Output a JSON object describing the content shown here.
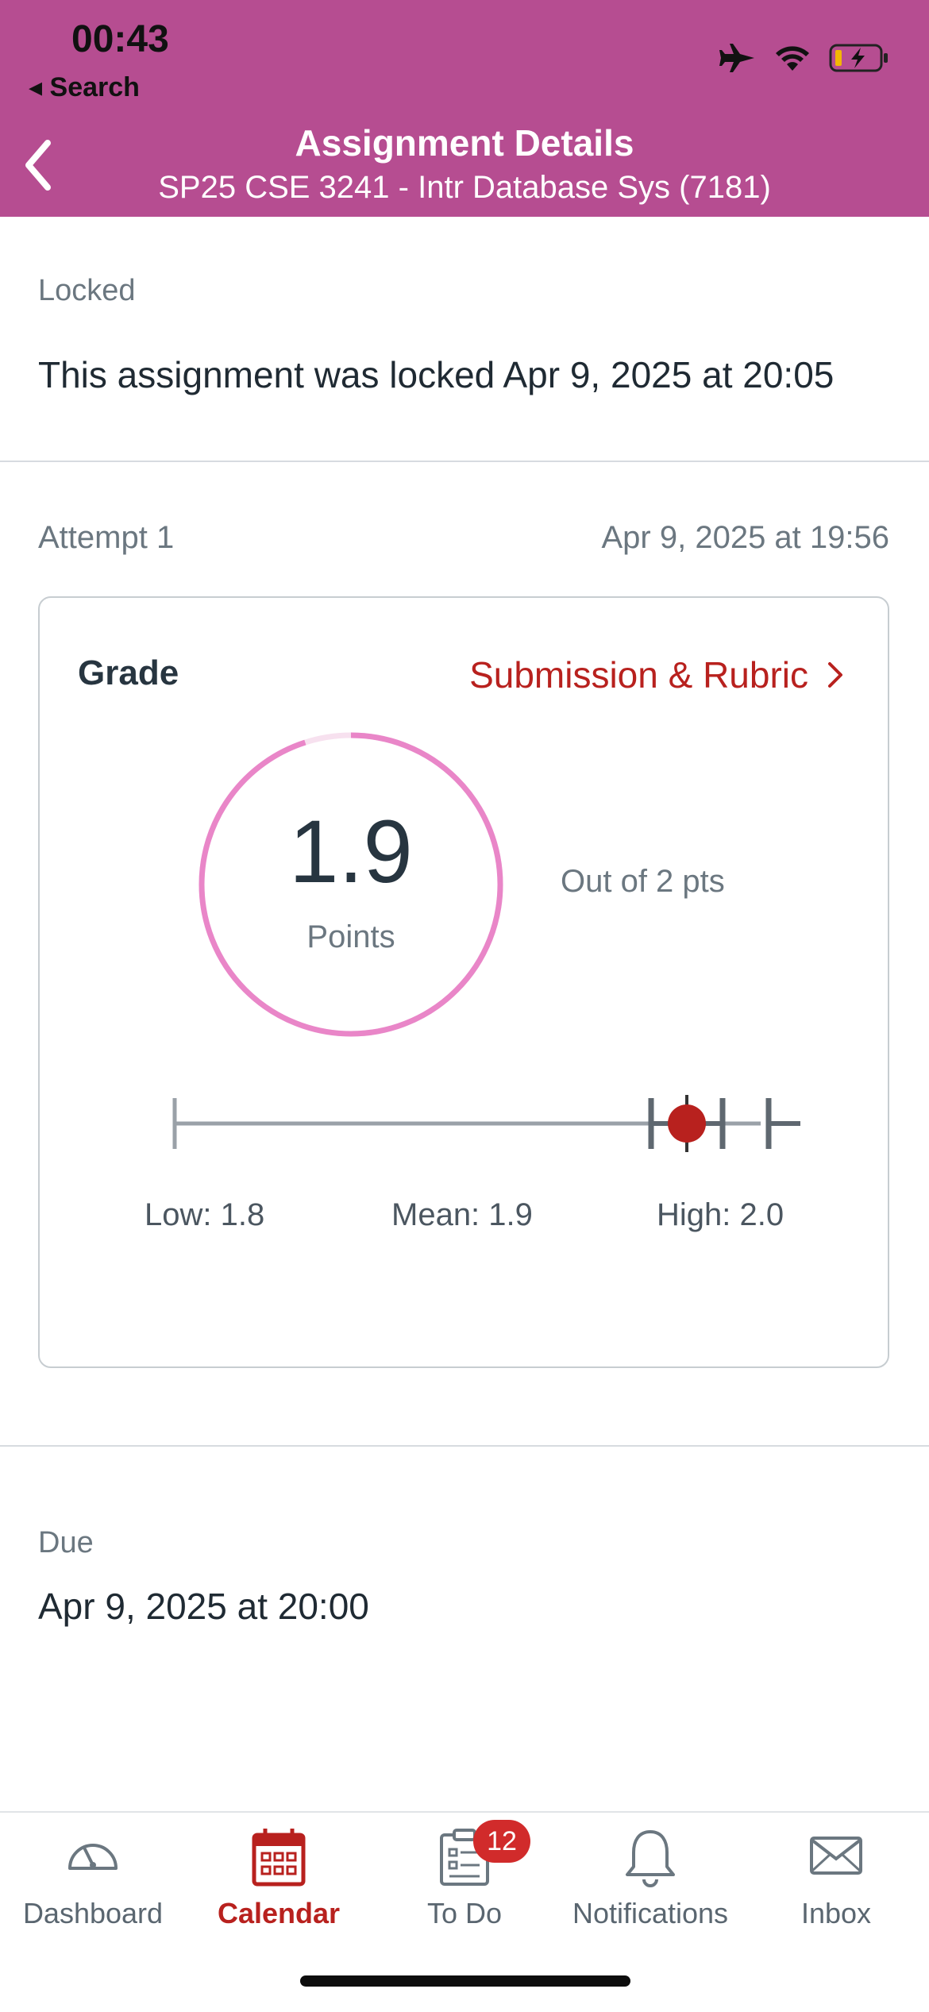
{
  "status_bar": {
    "time": "00:43",
    "back_app": "◂ Search"
  },
  "nav": {
    "title": "Assignment Details",
    "subtitle": "SP25 CSE 3241 - Intr Database Sys (7181)"
  },
  "locked": {
    "label": "Locked",
    "text": "This assignment was locked Apr 9, 2025 at 20:05"
  },
  "attempt": {
    "label": "Attempt 1",
    "date": "Apr 9, 2025 at 19:56"
  },
  "grade": {
    "title": "Grade",
    "rubric_link": "Submission & Rubric",
    "score": "1.9",
    "unit": "Points",
    "out_of": "Out of 2 pts",
    "score_fraction": 0.95,
    "stats": {
      "low": "Low: 1.8",
      "mean": "Mean: 1.9",
      "high": "High: 2.0"
    }
  },
  "due": {
    "label": "Due",
    "value": "Apr 9, 2025 at 20:00"
  },
  "tabbar": {
    "items": [
      {
        "label": "Dashboard",
        "icon": "dashboard-icon"
      },
      {
        "label": "Calendar",
        "icon": "calendar-icon",
        "active": true
      },
      {
        "label": "To Do",
        "icon": "todo-icon",
        "badge": "12"
      },
      {
        "label": "Notifications",
        "icon": "bell-icon"
      },
      {
        "label": "Inbox",
        "icon": "envelope-icon"
      }
    ]
  },
  "colors": {
    "header": "#B64D91",
    "accent": "#B8211E",
    "gauge": "#E986C8",
    "badge": "#D12B2B"
  }
}
